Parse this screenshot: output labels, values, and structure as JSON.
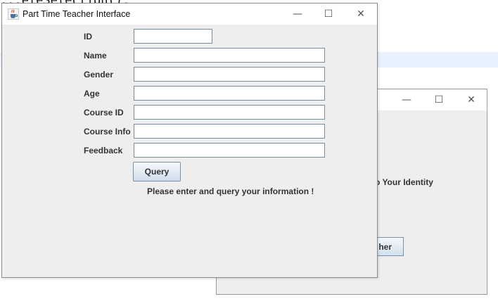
{
  "background": {
    "editor_code": "...eleSelection();"
  },
  "bg_window": {
    "controls": {
      "minimize": "—",
      "maximize": "☐",
      "close": "✕"
    },
    "text_fragment": "o Your Identity",
    "button_fragment": "her"
  },
  "window": {
    "title": "Part Time Teacher Interface",
    "icon": "java-cup-icon",
    "controls": {
      "minimize": "—",
      "maximize": "☐",
      "close": "✕"
    }
  },
  "form": {
    "fields": [
      {
        "label": "ID",
        "value": ""
      },
      {
        "label": "Name",
        "value": ""
      },
      {
        "label": "Gender",
        "value": ""
      },
      {
        "label": "Age",
        "value": ""
      },
      {
        "label": "Course ID",
        "value": ""
      },
      {
        "label": "Course Info",
        "value": ""
      },
      {
        "label": "Feedback",
        "value": ""
      }
    ],
    "query_label": "Query",
    "status_message": "Please enter and query your information !"
  }
}
